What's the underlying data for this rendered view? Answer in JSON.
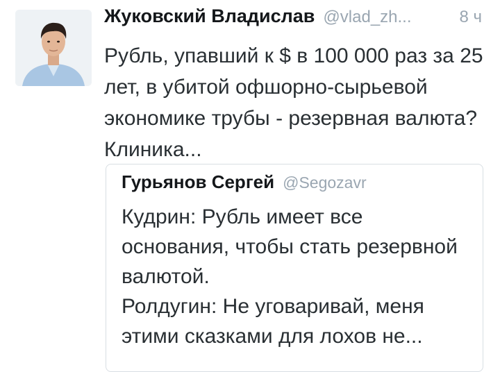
{
  "tweet": {
    "author_name": "Жуковский Владислав",
    "author_handle": "@vlad_zh...",
    "time": "8 ч",
    "text": "Рубль, упавший к $ в 100 000 раз за 25 лет, в убитой офшорно-сырьевой экономике трубы - резервная валюта? Клиника..."
  },
  "quoted": {
    "author_name": "Гурьянов Сергей",
    "author_handle": "@Segozavr",
    "lines": [
      "Кудрин: Рубль имеет все основания, чтобы стать резервной валютой.",
      "Ролдугин: Не уговаривай, меня этими сказками для лохов не..."
    ]
  }
}
